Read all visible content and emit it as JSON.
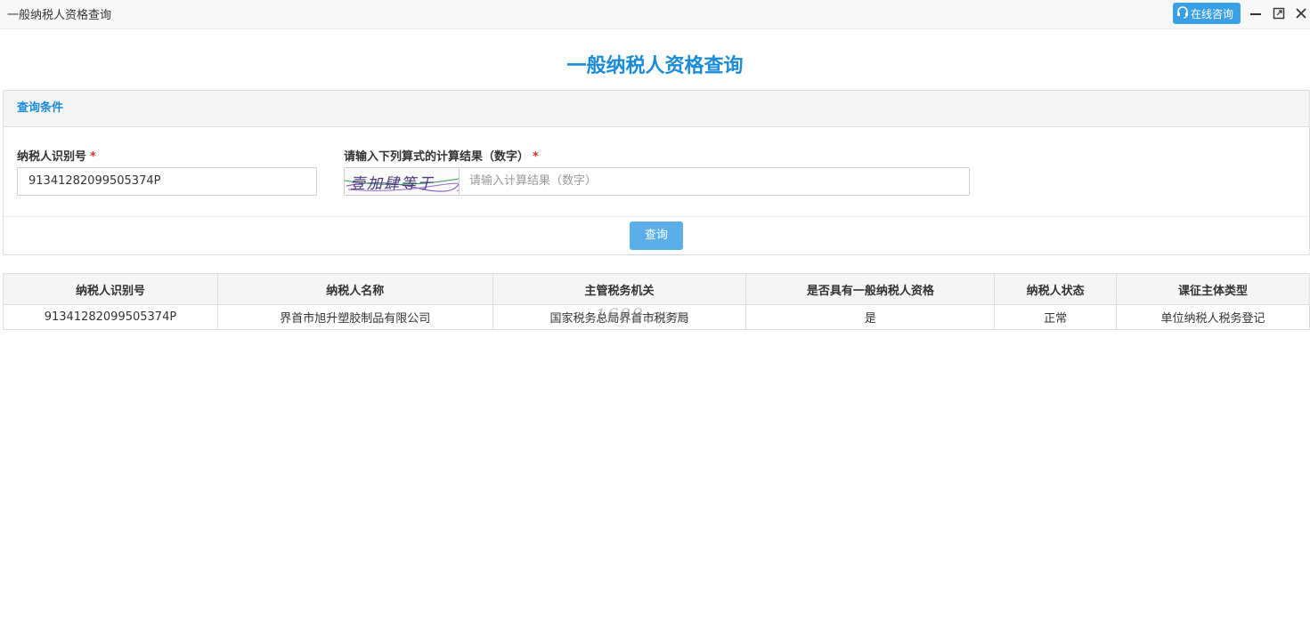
{
  "window": {
    "title": "一般纳税人资格查询",
    "consult_label": "在线咨询",
    "icons": {
      "consult": "headset-icon",
      "minimize": "minimize-icon",
      "maximize": "maximize-icon",
      "close": "close-icon"
    }
  },
  "page": {
    "title": "一般纳税人资格查询"
  },
  "query_panel": {
    "header": "查询条件",
    "tin_label": "纳税人识别号",
    "tin_value": "91341282099505374P",
    "calc_label": "请输入下列算式的计算结果（数字）",
    "required_mark": "*",
    "captcha_text": "壹加肆等于",
    "calc_placeholder": "请输入计算结果（数字）",
    "query_button": "查询"
  },
  "results": {
    "columns": [
      "纳税人识别号",
      "纳税人名称",
      "主管税务机关",
      "是否具有一般纳税人资格",
      "纳税人状态",
      "课征主体类型"
    ],
    "rows": [
      [
        "91341282099505374P",
        "界首市旭升塑胶制品有限公司",
        "国家税务总局界首市税务局",
        "是",
        "正常",
        "单位纳税人税务登记"
      ]
    ]
  },
  "watermark": "1688.com",
  "colors": {
    "accent": "#1a8bd6",
    "button": "#5caee8",
    "required": "#e0302a"
  }
}
